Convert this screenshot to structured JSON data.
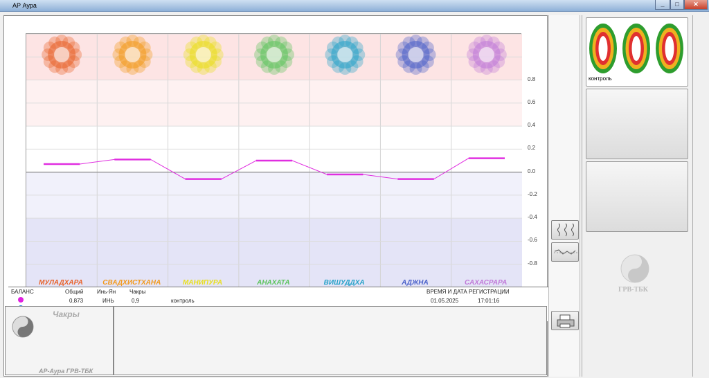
{
  "window": {
    "title": "АР Аура",
    "min": "_",
    "max": "□",
    "close": "✕"
  },
  "chart_data": {
    "type": "line",
    "categories": [
      "МУЛАДХАРА",
      "СВАДХИСТХАНА",
      "МАНИПУРА",
      "АНАХАТА",
      "ВИШУДДХА",
      "АДЖНА",
      "САХАСРАРА"
    ],
    "series": [
      {
        "values": [
          0.07,
          0.11,
          -0.06,
          0.1,
          -0.02,
          -0.06,
          0.12
        ]
      }
    ],
    "ylim": [
      -1.0,
      1.2
    ],
    "yticks": [
      "0.8",
      "0.6",
      "0.4",
      "0.2",
      "0.0",
      "-0.2",
      "-0.4",
      "-0.6",
      "-0.8"
    ],
    "category_colors": [
      "#e8632a",
      "#f29a1c",
      "#e9df1c",
      "#5cc45c",
      "#26a2c8",
      "#4a61c9",
      "#c07ad8"
    ],
    "line_color": "#e02ee0",
    "grid": true
  },
  "table": {
    "headers": {
      "balance": "БАЛАНС",
      "total": "Общий",
      "yinyang": "Инь-Ян",
      "chakras": "Чакры",
      "datetime": "ВРЕМЯ И ДАТА РЕГИСТРАЦИИ"
    },
    "row": {
      "total": "0,873",
      "yinyang": "ИНЬ",
      "chakras": "0,9",
      "name": "контроль",
      "date": "01.05.2025",
      "time": "17:01:16"
    },
    "dot_colors": [
      "#e020e0",
      "#2080e0",
      "#20c020"
    ]
  },
  "bottom_left": {
    "title": "Чакры",
    "subtitle": "АР-Аура ГРВ-ТБК"
  },
  "right_panel": {
    "thumb_label": "контроль",
    "brand": "ГРВ-ТБК"
  }
}
